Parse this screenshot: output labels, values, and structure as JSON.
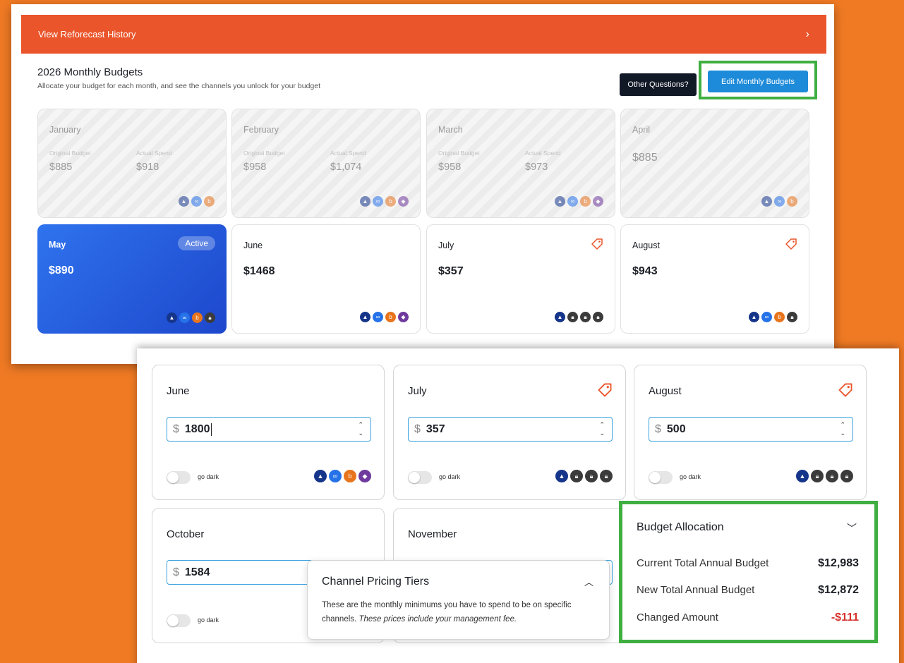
{
  "banner": {
    "label": "View Reforecast History",
    "chevron": "chevron-right-icon"
  },
  "header": {
    "title": "2026 Monthly Budgets",
    "subtitle": "Allocate your budget for each month, and see the channels you unlock for your budget",
    "other_questions": "Other Questions?",
    "edit_budgets": "Edit Monthly Budgets"
  },
  "labels": {
    "original_budget": "Original Budget",
    "actual_spend": "Actual Spend",
    "active": "Active",
    "go_dark": "go dark",
    "currency": "$"
  },
  "past_months": [
    {
      "name": "January",
      "original": "$885",
      "actual": "$918"
    },
    {
      "name": "February",
      "original": "$958",
      "actual": "$1,074"
    },
    {
      "name": "March",
      "original": "$958",
      "actual": "$973"
    },
    {
      "name": "April",
      "budget": "$885"
    }
  ],
  "current_months": [
    {
      "name": "May",
      "budget": "$890"
    },
    {
      "name": "June",
      "budget": "$1468"
    },
    {
      "name": "July",
      "budget": "$357"
    },
    {
      "name": "August",
      "budget": "$943"
    }
  ],
  "edit_months": [
    {
      "name": "June",
      "value": "1800"
    },
    {
      "name": "July",
      "value": "357"
    },
    {
      "name": "August",
      "value": "500"
    },
    {
      "name": "October",
      "value": "1584"
    },
    {
      "name": "November",
      "value": ""
    }
  ],
  "pricing_popup": {
    "title": "Channel Pricing Tiers",
    "body": "These are the monthly minimums you have to spend to be on specific channels.",
    "body_italic": "These prices include your management fee."
  },
  "allocation": {
    "title": "Budget Allocation",
    "rows": [
      {
        "label": "Current Total Annual Budget",
        "value": "$12,983"
      },
      {
        "label": "New Total Annual Budget",
        "value": "$12,872"
      },
      {
        "label": "Changed Amount",
        "value": "-$111"
      }
    ]
  },
  "colors": {
    "accent_orange": "#ea552b",
    "brand_blue": "#1d8bd9",
    "highlight_green": "#3faf41",
    "negative_red": "#d6312c"
  }
}
